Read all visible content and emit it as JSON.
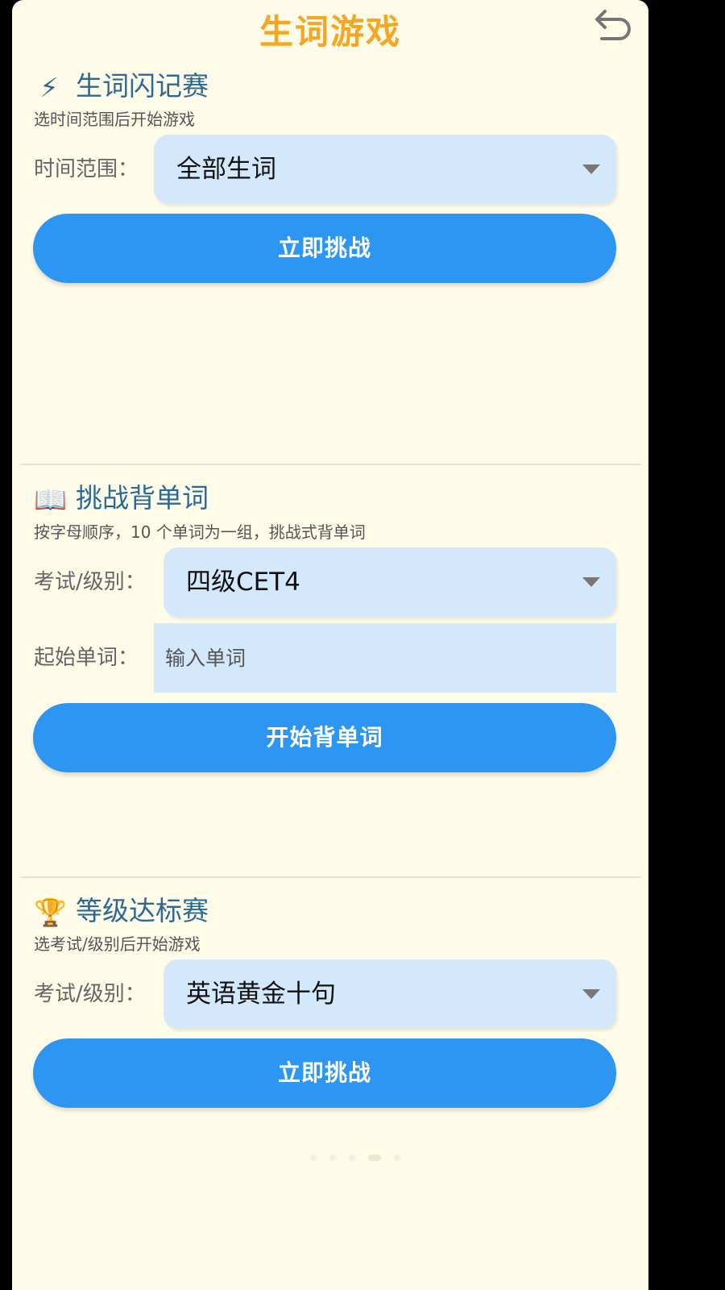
{
  "header": {
    "title": "生词游戏",
    "back_icon": "undo-arrow-icon"
  },
  "flash_game": {
    "icon": "⚡",
    "title": "生词闪记赛",
    "description": "选时间范围后开始游戏",
    "range_label": "时间范围：",
    "range_value": "全部生词",
    "button": "立即挑战"
  },
  "memorize_challenge": {
    "icon": "📖",
    "title": "挑战背单词",
    "description": "按字母顺序，10 个单词为一组，挑战式背单词",
    "level_label": "考试/级别：",
    "level_value": "四级CET4",
    "start_label": "起始单词：",
    "start_placeholder": "输入单词",
    "button": "开始背单词"
  },
  "level_contest": {
    "icon": "🏆",
    "title": "等级达标赛",
    "description": "选考试/级别后开始游戏",
    "level_label": "考试/级别：",
    "level_value": "英语黄金十句",
    "button": "立即挑战"
  },
  "colors": {
    "title": "#f5a623",
    "section_title": "#2b6a96",
    "button": "#2d96f2",
    "select_bg": "#d4e8fb",
    "background": "#fefbe8"
  }
}
